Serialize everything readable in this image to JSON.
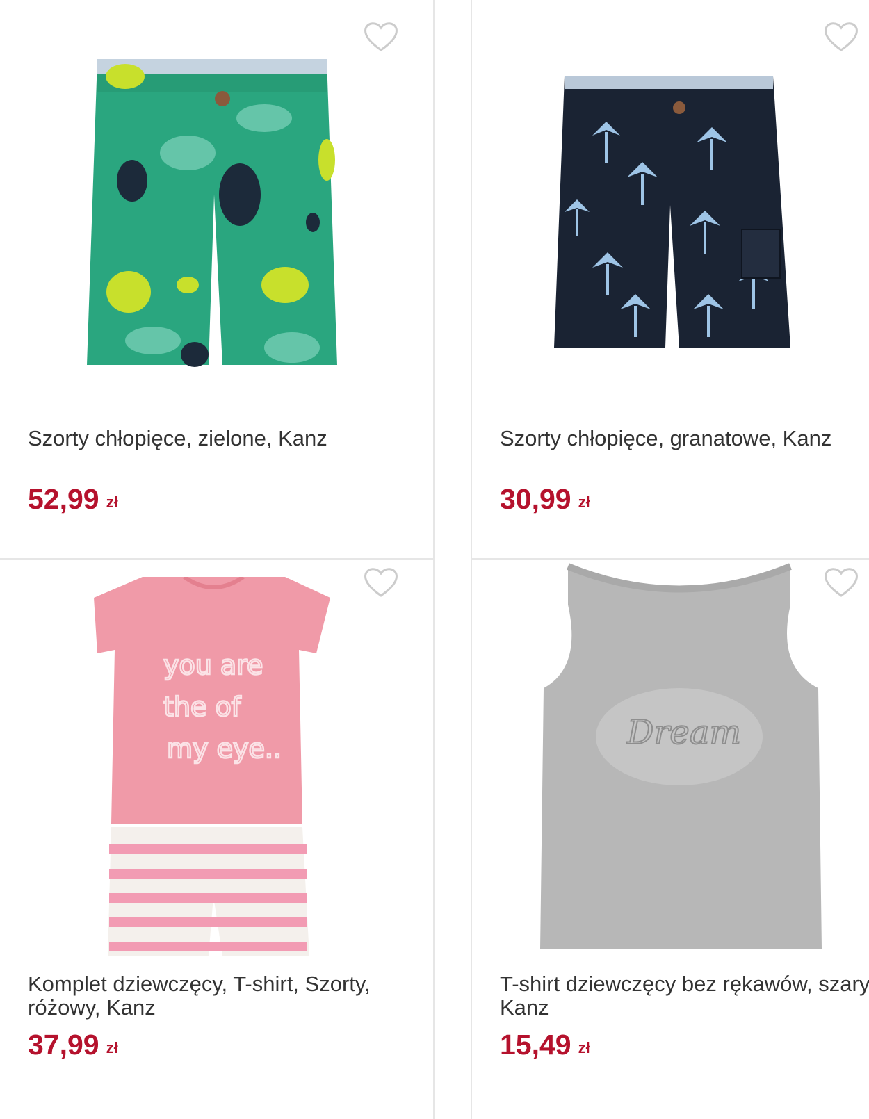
{
  "products": [
    {
      "title": "Szorty chłopięce, zielone, Kanz",
      "price": "52,99",
      "currency": "zł",
      "image": "green-tropical-shorts"
    },
    {
      "title": "Szorty chłopięce, granatowe, Kanz",
      "price": "30,99",
      "currency": "zł",
      "image": "navy-palm-cargo-shorts"
    },
    {
      "title": "Komplet dziewczęcy, T-shirt, Szorty, różowy, Kanz",
      "price": "37,99",
      "currency": "zł",
      "image": "pink-tshirt-striped-shorts-set"
    },
    {
      "title": "T-shirt dziewczęcy bez rękawów, szary, Kanz",
      "price": "15,49",
      "currency": "zł",
      "image": "grey-sleeveless-tshirt"
    }
  ],
  "icons": {
    "favorite": "heart-outline-icon"
  },
  "colors": {
    "price": "#b5122d",
    "title": "#333333",
    "divider": "#e6e6e6",
    "heart": "#cccccc"
  }
}
